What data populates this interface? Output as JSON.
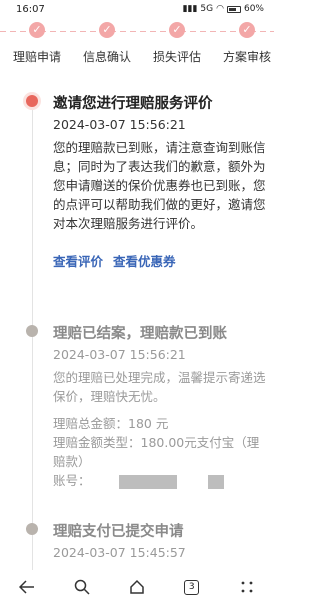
{
  "status_bar": {
    "time": "16:07",
    "network": "5G",
    "battery": "60%"
  },
  "steps": [
    {
      "label": "理赔申请"
    },
    {
      "label": "信息确认"
    },
    {
      "label": "损失评估"
    },
    {
      "label": "方案审核"
    }
  ],
  "timeline": [
    {
      "title": "邀请您进行理赔服务评价",
      "time": "2024-03-07 15:56:21",
      "description": "您的理赔款已到账，请注意查询到账信息；同时为了表达我们的歉意，额外为您申请赠送的保价优惠券也已到账，您的点评可以帮助我们做的更好，邀请您对本次理赔服务进行评价。",
      "links": {
        "review": "查看评价",
        "coupon": "查看优惠券"
      }
    },
    {
      "title": "理赔已结案，理赔款已到账",
      "time": "2024-03-07 15:56:21",
      "description": "您的理赔已处理完成，温馨提示寄递选保价，理赔快无忧。",
      "amount_label": "理赔总金额：",
      "amount_value": "180 元",
      "type_label": "理赔金额类型：",
      "type_value": "180.00元支付宝（理赔款）",
      "account_label": "账号："
    },
    {
      "title": "理赔支付已提交申请",
      "time": "2024-03-07 15:45:57"
    }
  ],
  "nav": {
    "tabs_count": "3"
  }
}
